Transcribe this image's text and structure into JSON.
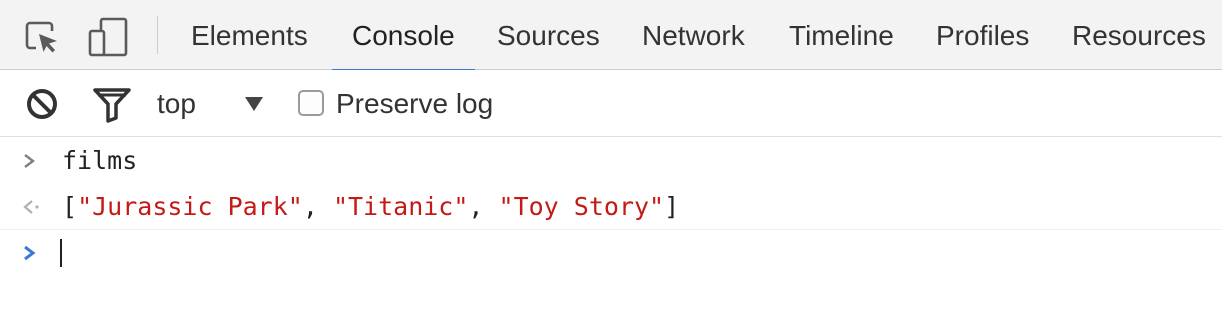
{
  "tabs": {
    "items": [
      {
        "label": "Elements",
        "active": false
      },
      {
        "label": "Console",
        "active": true
      },
      {
        "label": "Sources",
        "active": false
      },
      {
        "label": "Network",
        "active": false
      },
      {
        "label": "Timeline",
        "active": false
      },
      {
        "label": "Profiles",
        "active": false
      },
      {
        "label": "Resources",
        "active": false
      }
    ],
    "icons": [
      "inspect-element-icon",
      "device-mode-icon"
    ]
  },
  "toolbar": {
    "icons": [
      "clear-console-icon",
      "filter-icon",
      "dropdown-arrow-icon"
    ],
    "context": "top",
    "preserve_log": {
      "label": "Preserve log",
      "checked": false
    }
  },
  "console": {
    "command": "films",
    "result": {
      "open": "[",
      "items": [
        "\"Jurassic Park\"",
        "\"Titanic\"",
        "\"Toy Story\""
      ],
      "separator": ", ",
      "close": "]"
    },
    "input_value": ""
  },
  "colors": {
    "accent": "#3879d9",
    "string": "#c41a16",
    "tabbar_bg": "#f3f3f3"
  }
}
